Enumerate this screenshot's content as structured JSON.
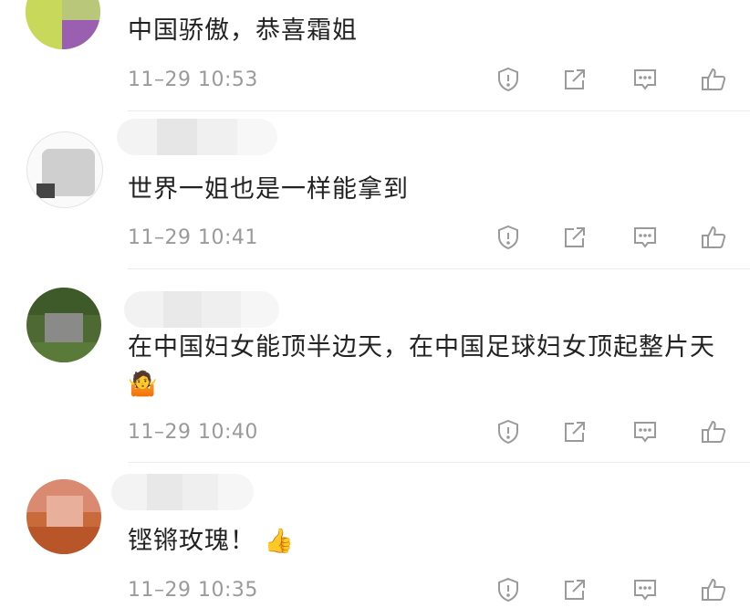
{
  "comments": [
    {
      "text": "中国骄傲，恭喜霜姐",
      "emoji": "",
      "time": "11–29 10:53"
    },
    {
      "text": "世界一姐也是一样能拿到",
      "emoji": "",
      "time": "11–29 10:41"
    },
    {
      "text": "在中国妇女能顶半边天，在中国足球妇女顶起整片天",
      "emoji": "🤷",
      "time": "11–29 10:40"
    },
    {
      "text": "铿锵玫瑰！",
      "emoji": "👍",
      "time": "11–29 10:35"
    }
  ],
  "actions": {
    "report": "shield-exclamation-icon",
    "share": "share-arrow-icon",
    "reply": "comment-icon",
    "like": "thumbs-up-icon"
  },
  "colors": {
    "text": "#222222",
    "timestamp": "#9a9a9a",
    "icon": "#9a9a9a",
    "divider": "#ececec"
  }
}
